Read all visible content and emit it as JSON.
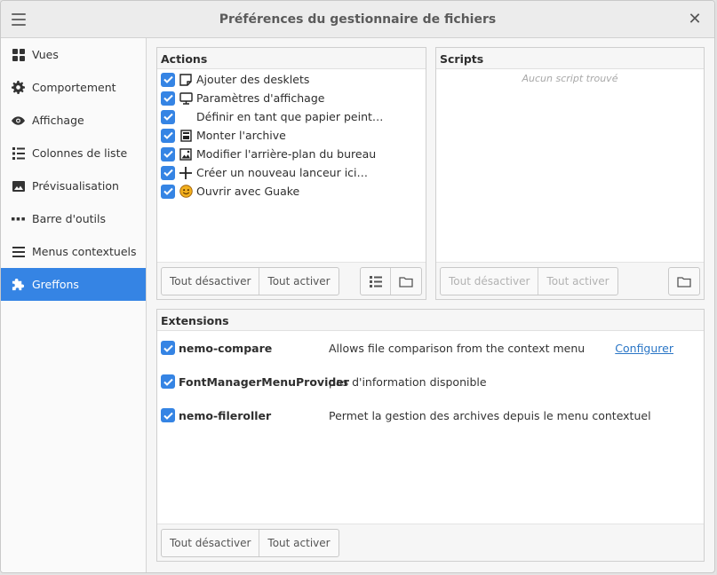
{
  "window": {
    "title": "Préférences du gestionnaire de fichiers"
  },
  "sidebar": {
    "items": [
      {
        "label": "Vues",
        "icon": "grid-icon"
      },
      {
        "label": "Comportement",
        "icon": "gear-icon"
      },
      {
        "label": "Affichage",
        "icon": "eye-icon"
      },
      {
        "label": "Colonnes de liste",
        "icon": "list-icon"
      },
      {
        "label": "Prévisualisation",
        "icon": "image-icon"
      },
      {
        "label": "Barre d'outils",
        "icon": "dots-icon"
      },
      {
        "label": "Menus contextuels",
        "icon": "menu-icon"
      },
      {
        "label": "Greffons",
        "icon": "puzzle-icon",
        "active": true
      }
    ]
  },
  "actions": {
    "title": "Actions",
    "items": [
      {
        "label": "Ajouter des desklets",
        "icon": "desklet-icon",
        "checked": true
      },
      {
        "label": "Paramètres d'affichage",
        "icon": "monitor-icon",
        "checked": true
      },
      {
        "label": "Définir en tant que papier peint…",
        "icon": "",
        "checked": true
      },
      {
        "label": "Monter l'archive",
        "icon": "archive-icon",
        "checked": true
      },
      {
        "label": "Modifier l'arrière-plan du bureau",
        "icon": "wallpaper-icon",
        "checked": true
      },
      {
        "label": "Créer un nouveau lanceur ici…",
        "icon": "plus-icon",
        "checked": true
      },
      {
        "label": "Ouvrir avec Guake",
        "icon": "guake-icon",
        "checked": true
      }
    ],
    "disable_all": "Tout désactiver",
    "enable_all": "Tout activer"
  },
  "scripts": {
    "title": "Scripts",
    "empty": "Aucun script trouvé",
    "disable_all": "Tout désactiver",
    "enable_all": "Tout activer"
  },
  "extensions": {
    "title": "Extensions",
    "items": [
      {
        "name": "nemo-compare",
        "description": "Allows file comparison from the context menu",
        "link": "Configurer"
      },
      {
        "name": "FontManagerMenuProvider",
        "description": "pas d'information disponible",
        "link": ""
      },
      {
        "name": "nemo-fileroller",
        "description": "Permet la gestion des archives depuis le menu contextuel",
        "link": ""
      }
    ],
    "disable_all": "Tout désactiver",
    "enable_all": "Tout activer"
  },
  "colors": {
    "accent": "#3584e4",
    "link": "#2a76c6"
  }
}
